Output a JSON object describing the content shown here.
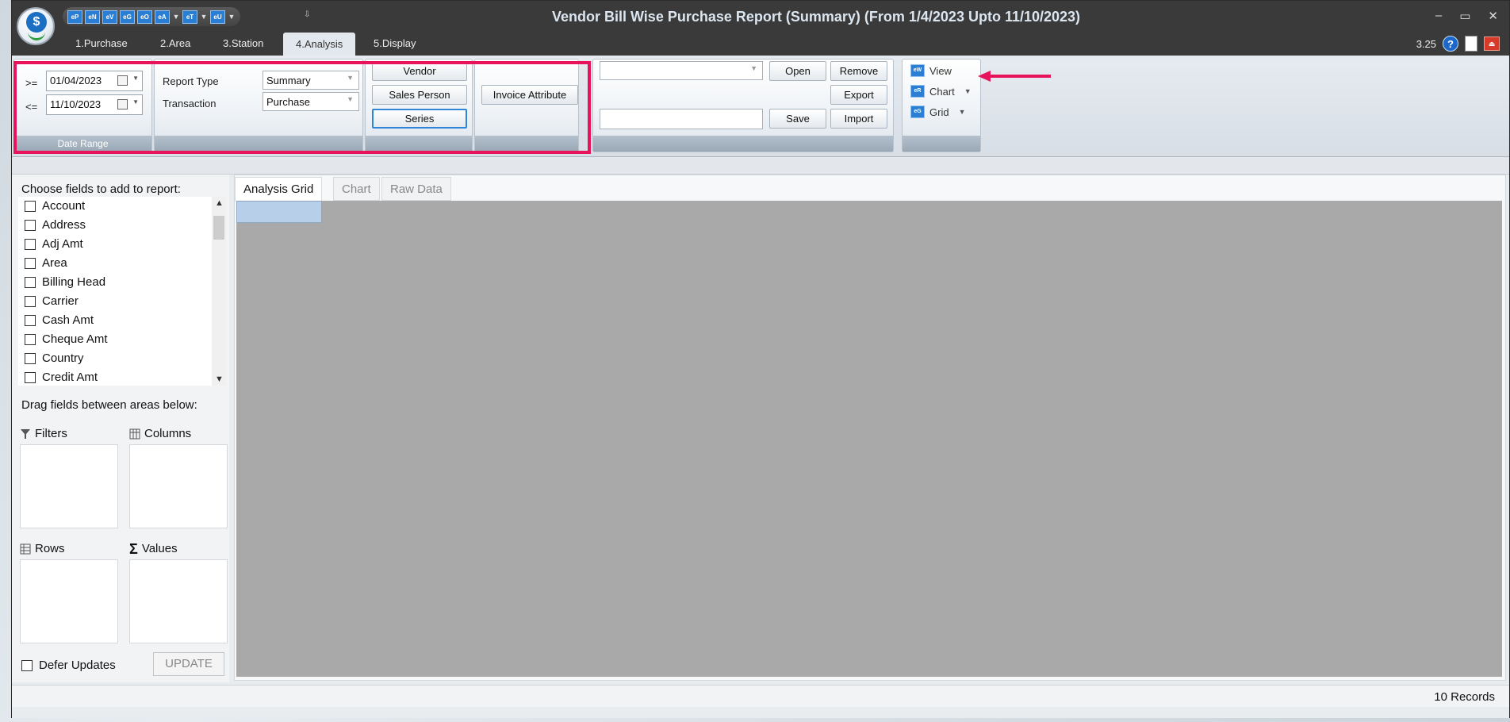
{
  "titlebar": {
    "title": "Vendor Bill Wise Purchase Report (Summary) (From 1/4/2023 Upto 11/10/2023)",
    "logo_letter": "$",
    "quick_access": [
      "eP",
      "eN",
      "eV",
      "eG",
      "eO",
      "eA",
      "eT",
      "eU"
    ],
    "controls": [
      "–",
      "▭",
      "✕"
    ]
  },
  "ribbon_tabs": [
    {
      "label": "1.Purchase"
    },
    {
      "label": "2.Area"
    },
    {
      "label": "3.Station"
    },
    {
      "label": "4.Analysis",
      "active": true
    },
    {
      "label": "5.Display"
    }
  ],
  "tabrow_right": {
    "version": "3.25",
    "help": "?"
  },
  "date_range": {
    "from_op": ">=",
    "from_value": "01/04/2023",
    "to_op": "<=",
    "to_value": "11/10/2023",
    "group_label": "Date Range"
  },
  "report": {
    "report_type_label": "Report Type",
    "report_type_value": "Summary",
    "transaction_label": "Transaction",
    "transaction_value": "Purchase"
  },
  "filters_group": {
    "vendor": "Vendor",
    "sales_person": "Sales Person",
    "series": "Series",
    "invoice_attribute": "Invoice Attribute"
  },
  "layout_group": {
    "layout_value": "",
    "name_value": "",
    "open": "Open",
    "remove": "Remove",
    "export": "Export",
    "save": "Save",
    "import": "Import"
  },
  "view_group": {
    "items": [
      {
        "icon": "eW",
        "label": "View"
      },
      {
        "icon": "eR",
        "label": "Chart"
      },
      {
        "icon": "eG",
        "label": "Grid"
      }
    ]
  },
  "annotation": {
    "highlight_color": "#e8145b"
  },
  "field_chooser": {
    "title": "Choose fields to add to report:",
    "fields": [
      "Account",
      "Address",
      "Adj Amt",
      "Area",
      "Billing Head",
      "Carrier",
      "Cash Amt",
      "Cheque Amt",
      "Country",
      "Credit Amt"
    ],
    "drag_hint": "Drag fields between areas below:",
    "areas": {
      "filters": "Filters",
      "columns": "Columns",
      "rows": "Rows",
      "values": "Values"
    },
    "defer_label": "Defer Updates",
    "update_label": "UPDATE"
  },
  "panel_tabs": [
    {
      "label": "Analysis Grid",
      "active": true
    },
    {
      "label": "Chart"
    },
    {
      "label": "Raw Data"
    }
  ],
  "status": {
    "records": "10 Records"
  }
}
